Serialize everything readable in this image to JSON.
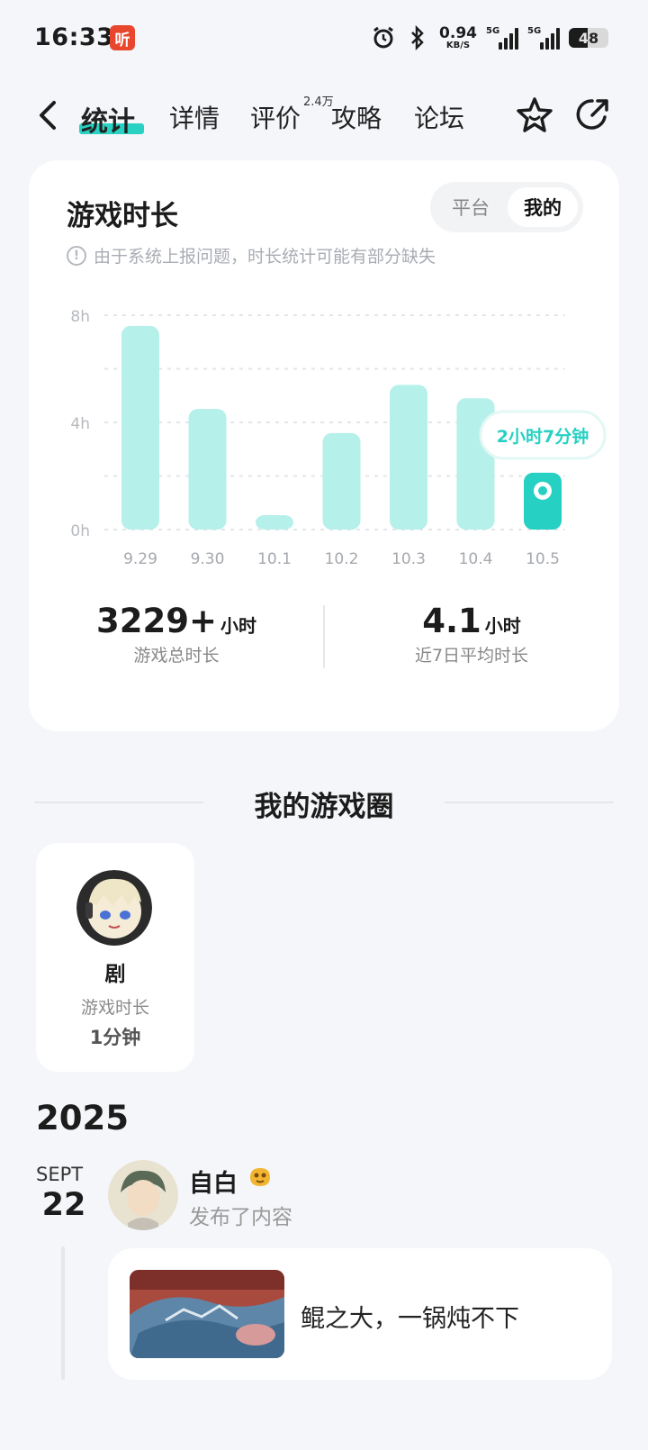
{
  "status_bar": {
    "time": "16:33",
    "app_icon_text": "听",
    "net_speed": "0.94",
    "net_unit": "KB/S",
    "signal1_label": "5G",
    "signal2_label": "5G",
    "battery": "48",
    "battery_level": 0.48,
    "icons": [
      "alarm-icon",
      "bluetooth-icon",
      "signal-icon",
      "signal-icon",
      "battery-icon"
    ]
  },
  "nav": {
    "tabs": [
      {
        "label": "统计",
        "active": true
      },
      {
        "label": "详情"
      },
      {
        "label": "评价",
        "badge": "2.4万"
      },
      {
        "label": "攻略"
      },
      {
        "label": "论坛"
      }
    ],
    "icons": [
      "back-icon",
      "star-icon",
      "share-icon"
    ]
  },
  "playtime_card": {
    "title": "游戏时长",
    "segment_off": "平台",
    "segment_on": "我的",
    "notice": "由于系统上报问题，时长统计可能有部分缺失",
    "total_value": "3229+",
    "total_unit": "小时",
    "total_caption": "游戏总时长",
    "avg_value": "4.1",
    "avg_unit": "小时",
    "avg_caption": "近7日平均时长"
  },
  "chart_data": {
    "type": "bar",
    "categories": [
      "9.29",
      "9.30",
      "10.1",
      "10.2",
      "10.3",
      "10.4",
      "10.5"
    ],
    "values": [
      7.6,
      4.5,
      0.5,
      3.6,
      5.4,
      4.9,
      2.12
    ],
    "ylim": [
      0,
      8
    ],
    "yticks": [
      "0h",
      "4h",
      "8h"
    ],
    "highlight_index": 6,
    "highlight_label": "2小时7分钟",
    "bar_color": "#b5f0ea",
    "highlight_color": "#26d0c2",
    "grid": true
  },
  "game_circle": {
    "section_title": "我的游戏圈",
    "name": "剧",
    "caption": "游戏时长",
    "value": "1分钟"
  },
  "timeline": {
    "year": "2025",
    "month": "SEPT",
    "day": "22",
    "user_name": "自白",
    "action": "发布了内容",
    "post_text": "鲲之大，一锅炖不下"
  }
}
